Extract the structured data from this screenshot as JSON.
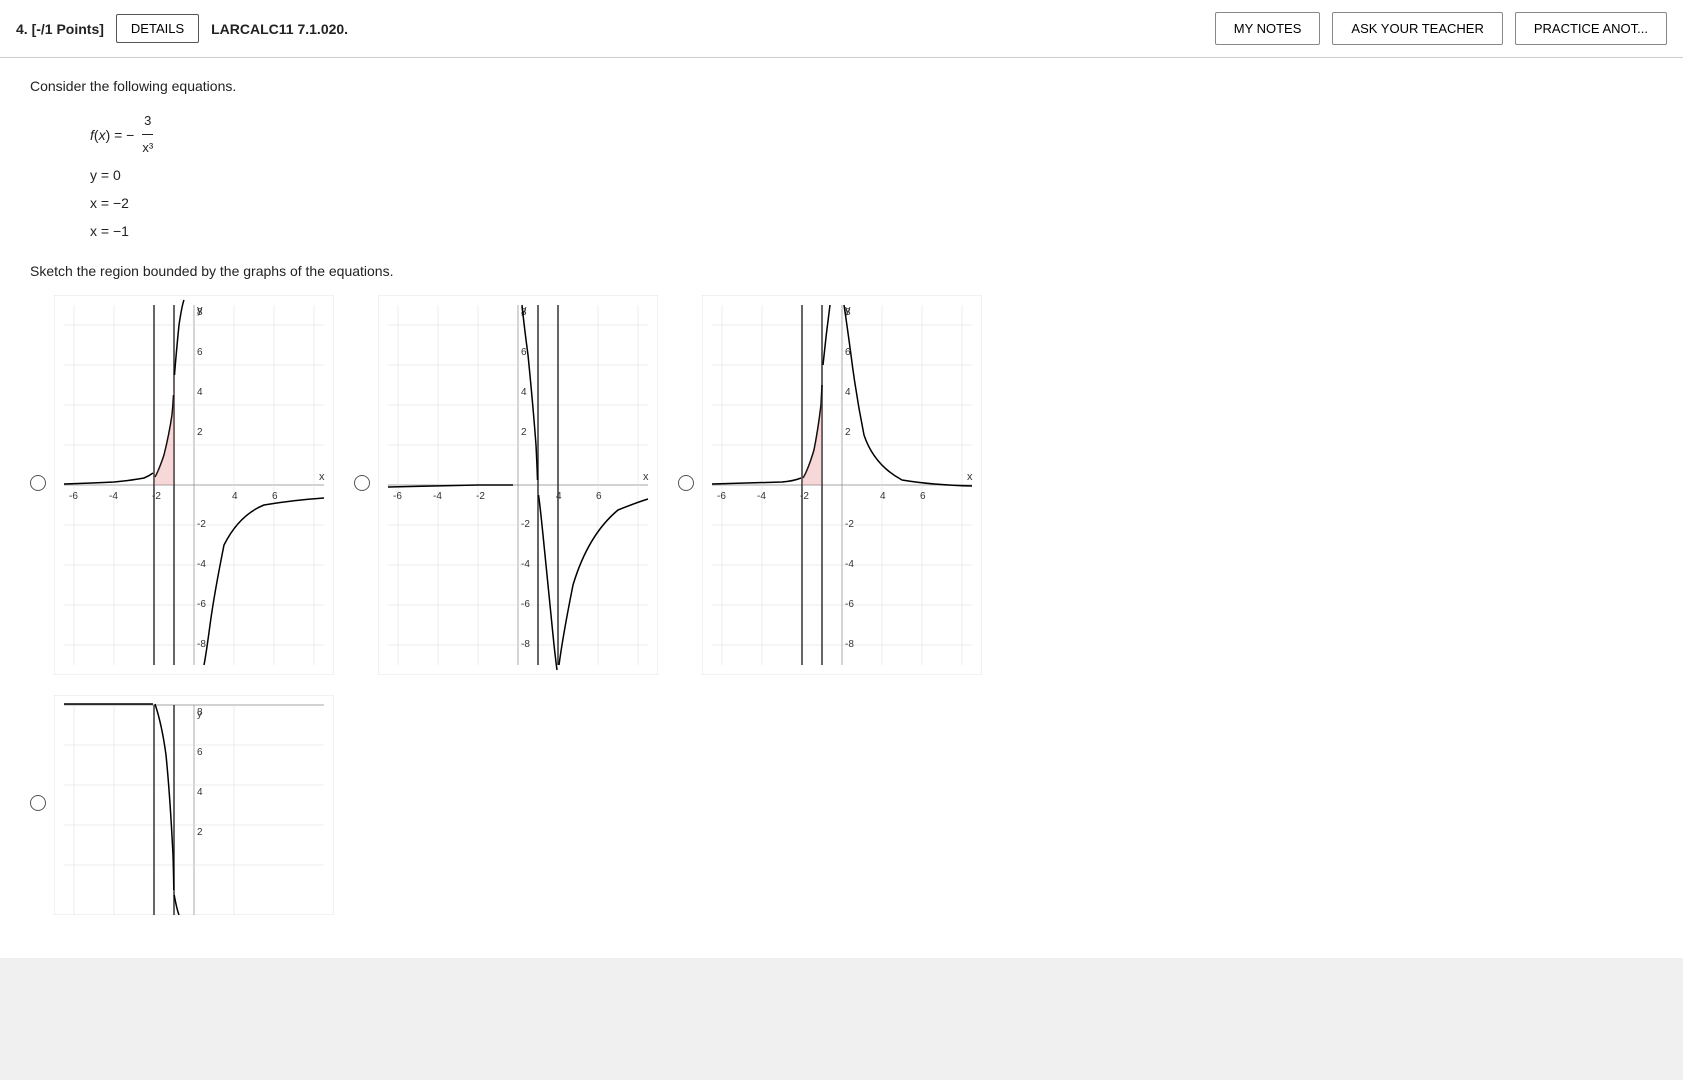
{
  "header": {
    "question_number": "4.  [-/1 Points]",
    "details_label": "DETAILS",
    "problem_id": "LARCALC11 7.1.020.",
    "my_notes_label": "MY NOTES",
    "ask_teacher_label": "ASK YOUR TEACHER",
    "practice_label": "PRACTICE ANOT..."
  },
  "content": {
    "consider_text": "Consider the following equations.",
    "function_label": "f(x) = −",
    "numerator": "3",
    "denominator": "x³",
    "eq2": "y = 0",
    "eq3": "x = −2",
    "eq4": "x = −1",
    "sketch_text": "Sketch the region bounded by the graphs of the equations."
  },
  "graphs": [
    {
      "id": "graph1",
      "selected": false
    },
    {
      "id": "graph2",
      "selected": false
    },
    {
      "id": "graph3",
      "selected": false
    },
    {
      "id": "graph4",
      "selected": false
    },
    {
      "id": "graph5",
      "selected": false
    }
  ]
}
